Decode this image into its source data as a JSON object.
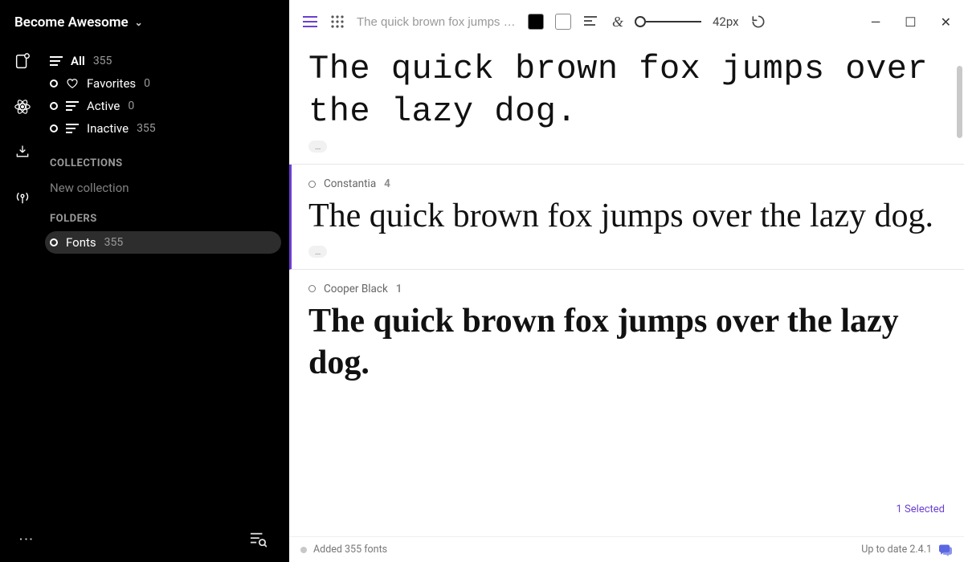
{
  "sidebar": {
    "workspace": "Become Awesome",
    "nav": [
      {
        "label": "All",
        "count": "355"
      },
      {
        "label": "Favorites",
        "count": "0"
      },
      {
        "label": "Active",
        "count": "0"
      },
      {
        "label": "Inactive",
        "count": "355"
      }
    ],
    "collections_header": "COLLECTIONS",
    "new_collection": "New collection",
    "folders_header": "FOLDERS",
    "folders": [
      {
        "label": "Fonts",
        "count": "355",
        "selected": true
      }
    ]
  },
  "toolbar": {
    "preview_text": "The quick brown fox jumps over the lazy dog",
    "size_label": "42px"
  },
  "fonts": [
    {
      "name": "",
      "count": "",
      "sample": "The quick brown fox jumps over the lazy dog.",
      "show_meta": false
    },
    {
      "name": "Constantia",
      "count": "4",
      "sample": "The quick brown fox jumps over the lazy dog.",
      "show_meta": true,
      "selected": true
    },
    {
      "name": "Cooper Black",
      "count": "1",
      "sample": "The quick brown fox jumps over the lazy dog.",
      "show_meta": true
    }
  ],
  "selected_label": "1 Selected",
  "status": {
    "left": "Added 355 fonts",
    "right": "Up to date 2.4.1"
  }
}
